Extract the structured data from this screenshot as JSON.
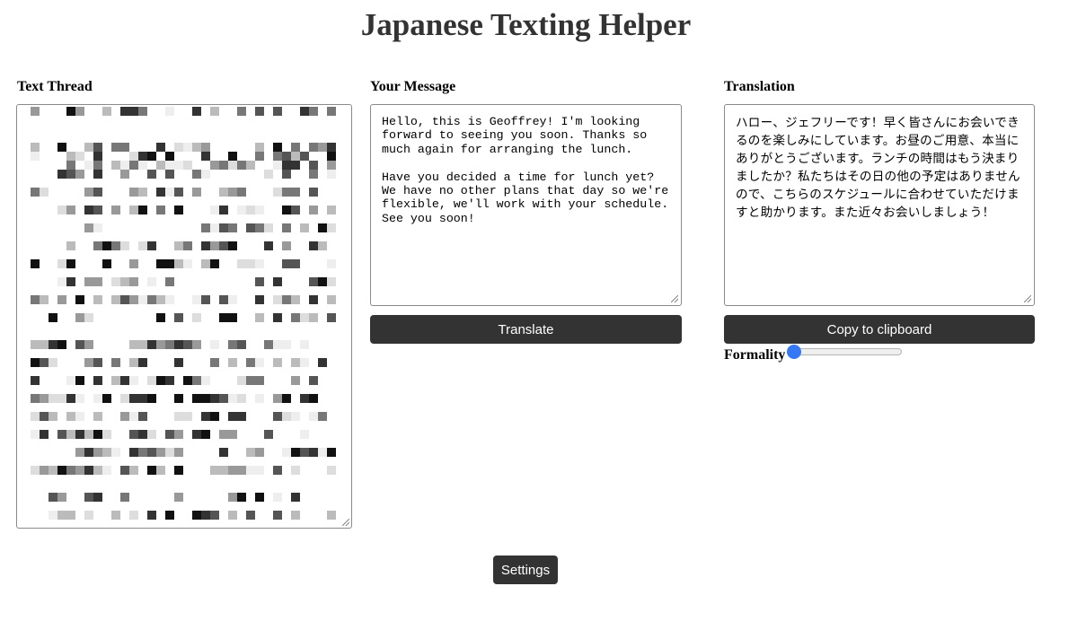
{
  "app": {
    "title": "Japanese Texting Helper"
  },
  "thread": {
    "label": "Text Thread"
  },
  "message": {
    "label": "Your Message",
    "value": "Hello, this is Geoffrey! I'm looking forward to seeing you soon. Thanks so much again for arranging the lunch.\n\nHave you decided a time for lunch yet? We have no other plans that day so we're flexible, we'll work with your schedule. See you soon!"
  },
  "translation": {
    "label": "Translation",
    "value": "ハロー、ジェフリーです！早く皆さんにお会いできるのを楽しみにしています。お昼のご用意、本当にありがとうございます。ランチの時間はもう決まりましたか？私たちはその日の他の予定はありませんので、こちらのスケジュールに合わせていただけますと助かります。また近々お会いしましょう！"
  },
  "buttons": {
    "translate": "Translate",
    "copy": "Copy to clipboard",
    "settings": "Settings"
  },
  "formality": {
    "label": "Formality",
    "value": 0
  },
  "colors": {
    "button_bg": "#333333",
    "slider_accent": "#3478f6"
  }
}
